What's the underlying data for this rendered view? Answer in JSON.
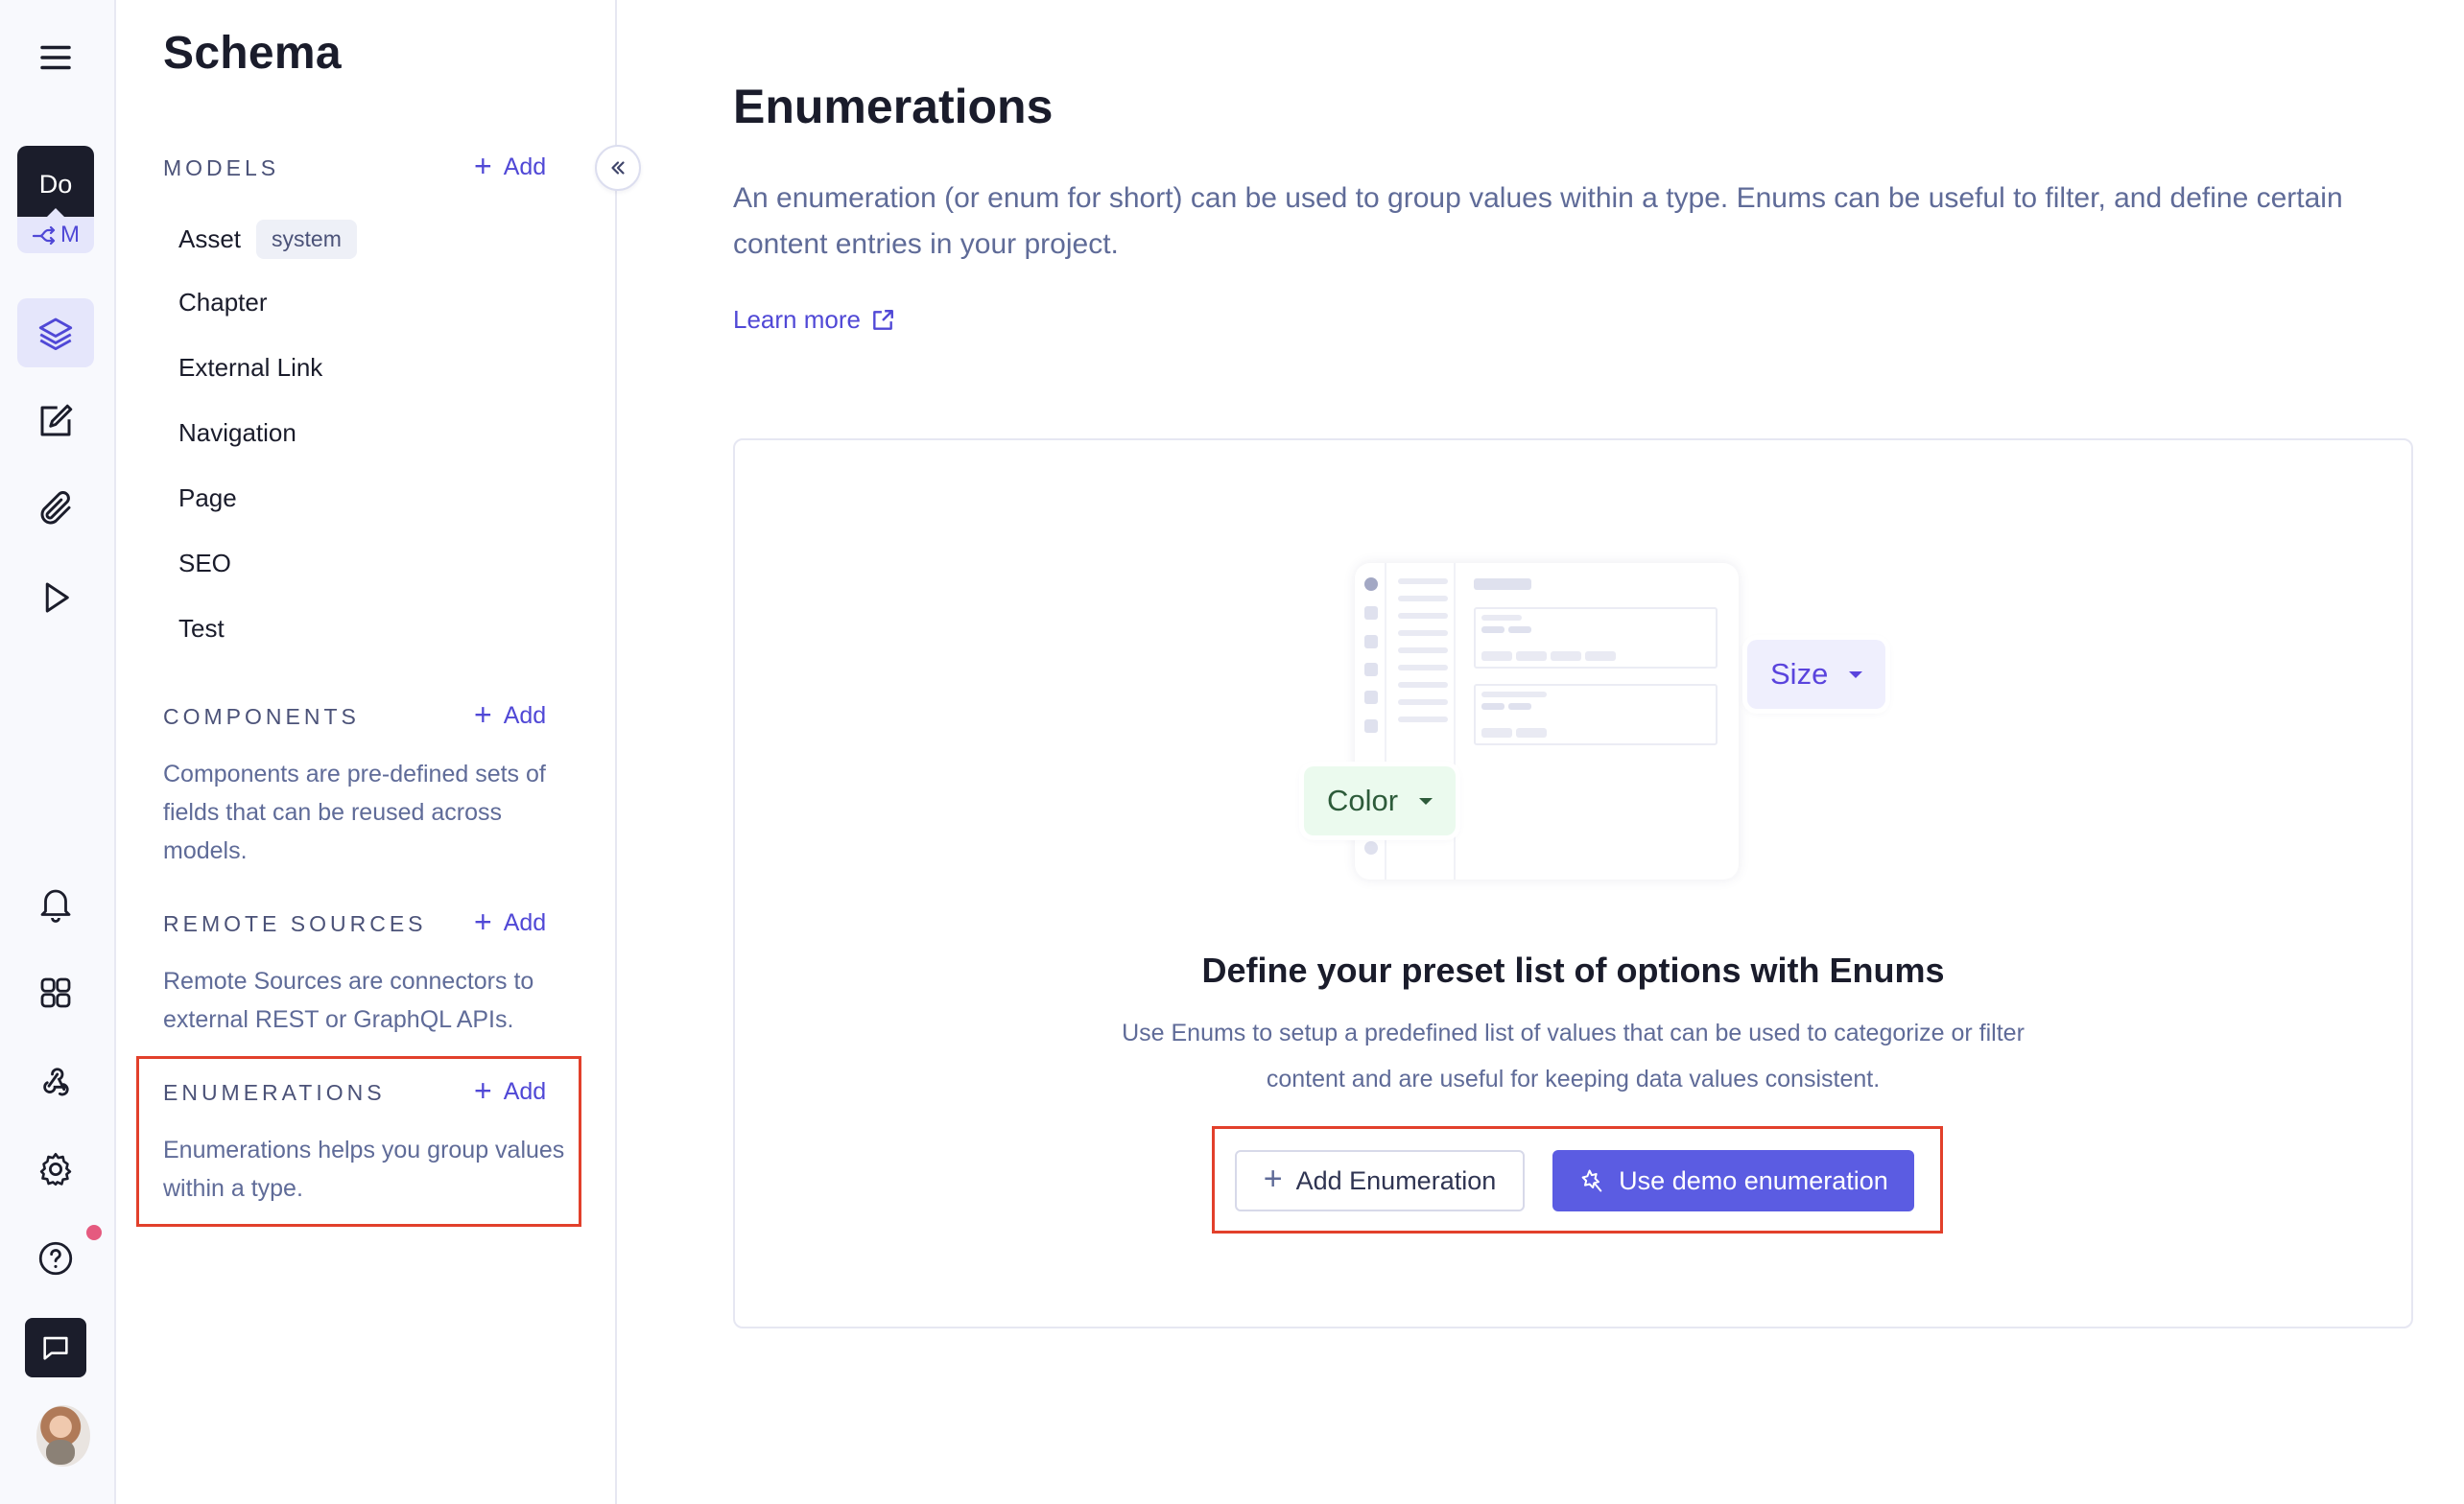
{
  "rail": {
    "workspace": {
      "initials": "Do",
      "environment": "M"
    },
    "top_items": [
      {
        "id": "menu",
        "icon": "hamburger-menu-icon"
      },
      {
        "id": "schema",
        "icon": "layers-icon",
        "active": true
      },
      {
        "id": "content",
        "icon": "edit-icon"
      },
      {
        "id": "assets",
        "icon": "paperclip-icon"
      },
      {
        "id": "playground",
        "icon": "play-icon"
      }
    ],
    "bottom_items": [
      {
        "id": "notifications",
        "icon": "bell-icon"
      },
      {
        "id": "apps",
        "icon": "apps-grid-icon"
      },
      {
        "id": "webhooks",
        "icon": "webhook-icon"
      },
      {
        "id": "settings",
        "icon": "gear-icon"
      },
      {
        "id": "help",
        "icon": "help-circle-icon",
        "has_notification": true
      },
      {
        "id": "chat",
        "icon": "chat-icon"
      },
      {
        "id": "profile",
        "icon": "avatar"
      }
    ]
  },
  "sidebar": {
    "title": "Schema",
    "add_label": "Add",
    "models": {
      "heading": "MODELS",
      "items": [
        {
          "label": "Asset",
          "badge": "system"
        },
        {
          "label": "Chapter"
        },
        {
          "label": "External Link"
        },
        {
          "label": "Navigation"
        },
        {
          "label": "Page"
        },
        {
          "label": "SEO"
        },
        {
          "label": "Test"
        }
      ]
    },
    "components": {
      "heading": "COMPONENTS",
      "description": "Components are pre-defined sets of fields that can be reused across models."
    },
    "remote_sources": {
      "heading": "REMOTE SOURCES",
      "description": "Remote Sources are connectors to external REST or GraphQL APIs."
    },
    "enumerations": {
      "heading": "ENUMERATIONS",
      "description": "Enumerations helps you group values within a type."
    }
  },
  "main": {
    "title": "Enumerations",
    "description": "An enumeration (or enum for short) can be used to group values within a type. Enums can be useful to filter, and define certain content entries in your project.",
    "learn_more": "Learn more",
    "empty_state": {
      "illustration": {
        "color_pill": "Color",
        "size_pill": "Size"
      },
      "title": "Define your preset list of options with Enums",
      "description": "Use Enums to setup a predefined list of values that can be used to categorize or filter content and are useful for keeping data values consistent.",
      "add_button": "Add Enumeration",
      "demo_button": "Use demo enumeration"
    }
  },
  "colors": {
    "accent": "#5b5ce2",
    "link": "#5048d6",
    "highlight": "#e2402b",
    "notification": "#e55a7f"
  }
}
